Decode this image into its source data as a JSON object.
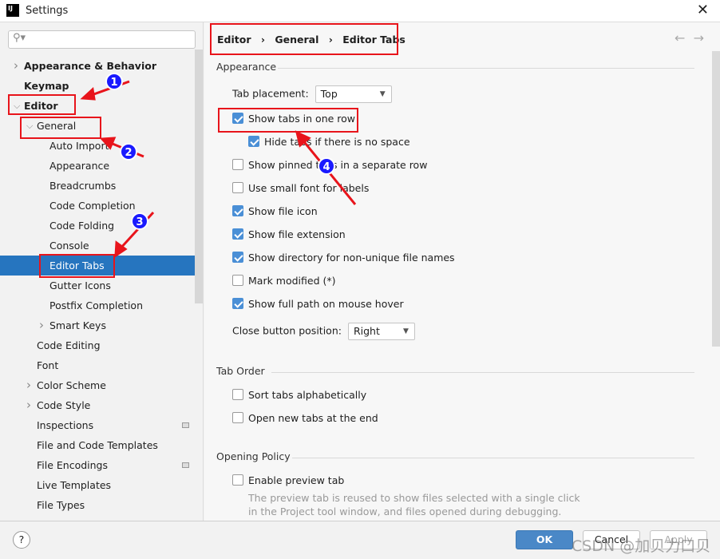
{
  "window": {
    "title": "Settings",
    "logo": "IJ",
    "close_icon": "close-icon"
  },
  "search": {
    "placeholder": "",
    "icon": "search-icon"
  },
  "tree": [
    {
      "label": "Appearance & Behavior",
      "level": 0,
      "bold": true,
      "chevron": "right"
    },
    {
      "label": "Keymap",
      "level": 0,
      "bold": true
    },
    {
      "label": "Editor",
      "level": 0,
      "bold": true,
      "chevron": "down"
    },
    {
      "label": "General",
      "level": 1,
      "chevron": "down"
    },
    {
      "label": "Auto Import",
      "level": 2
    },
    {
      "label": "Appearance",
      "level": 2
    },
    {
      "label": "Breadcrumbs",
      "level": 2
    },
    {
      "label": "Code Completion",
      "level": 2
    },
    {
      "label": "Code Folding",
      "level": 2
    },
    {
      "label": "Console",
      "level": 2
    },
    {
      "label": "Editor Tabs",
      "level": 2,
      "selected": true
    },
    {
      "label": "Gutter Icons",
      "level": 2
    },
    {
      "label": "Postfix Completion",
      "level": 2
    },
    {
      "label": "Smart Keys",
      "level": 2,
      "chevron": "right"
    },
    {
      "label": "Code Editing",
      "level": 1
    },
    {
      "label": "Font",
      "level": 1
    },
    {
      "label": "Color Scheme",
      "level": 1,
      "chevron": "right"
    },
    {
      "label": "Code Style",
      "level": 1,
      "chevron": "right"
    },
    {
      "label": "Inspections",
      "level": 1,
      "badge": true
    },
    {
      "label": "File and Code Templates",
      "level": 1
    },
    {
      "label": "File Encodings",
      "level": 1,
      "badge": true
    },
    {
      "label": "Live Templates",
      "level": 1
    },
    {
      "label": "File Types",
      "level": 1
    }
  ],
  "breadcrumb": {
    "items": [
      "Editor",
      "General",
      "Editor Tabs"
    ],
    "sep": "›",
    "back": "←",
    "forward": "→"
  },
  "appearance": {
    "title": "Appearance",
    "tab_placement_label": "Tab placement:",
    "tab_placement": "Top",
    "options": [
      {
        "label": "Show tabs in one row",
        "checked": true,
        "indent": false
      },
      {
        "label": "Hide tabs if there is no space",
        "checked": true,
        "indent": true
      },
      {
        "label": "Show pinned tabs in a separate row",
        "checked": false,
        "indent": false
      },
      {
        "label": "Use small font for labels",
        "checked": false,
        "indent": false
      },
      {
        "label": "Show file icon",
        "checked": true,
        "indent": false
      },
      {
        "label": "Show file extension",
        "checked": true,
        "indent": false
      },
      {
        "label": "Show directory for non-unique file names",
        "checked": true,
        "indent": false
      },
      {
        "label": "Mark modified (*)",
        "checked": false,
        "indent": false
      },
      {
        "label": "Show full path on mouse hover",
        "checked": true,
        "indent": false
      }
    ],
    "close_button_label": "Close button position:",
    "close_button": "Right"
  },
  "tab_order": {
    "title": "Tab Order",
    "options": [
      {
        "label": "Sort tabs alphabetically",
        "checked": false
      },
      {
        "label": "Open new tabs at the end",
        "checked": false
      }
    ]
  },
  "opening_policy": {
    "title": "Opening Policy",
    "preview_label": "Enable preview tab",
    "preview_checked": false,
    "desc1": "The preview tab is reused to show files selected with a single click",
    "desc2": "in the Project tool window, and files opened during debugging."
  },
  "footer": {
    "help": "?",
    "ok": "OK",
    "cancel": "Cancel",
    "apply": "Apply"
  },
  "annotations": {
    "steps": [
      "1",
      "2",
      "3",
      "4"
    ],
    "color": "#e8141b",
    "badge_color": "#1a1aff"
  },
  "watermark": "CSDN @加贝力口贝"
}
